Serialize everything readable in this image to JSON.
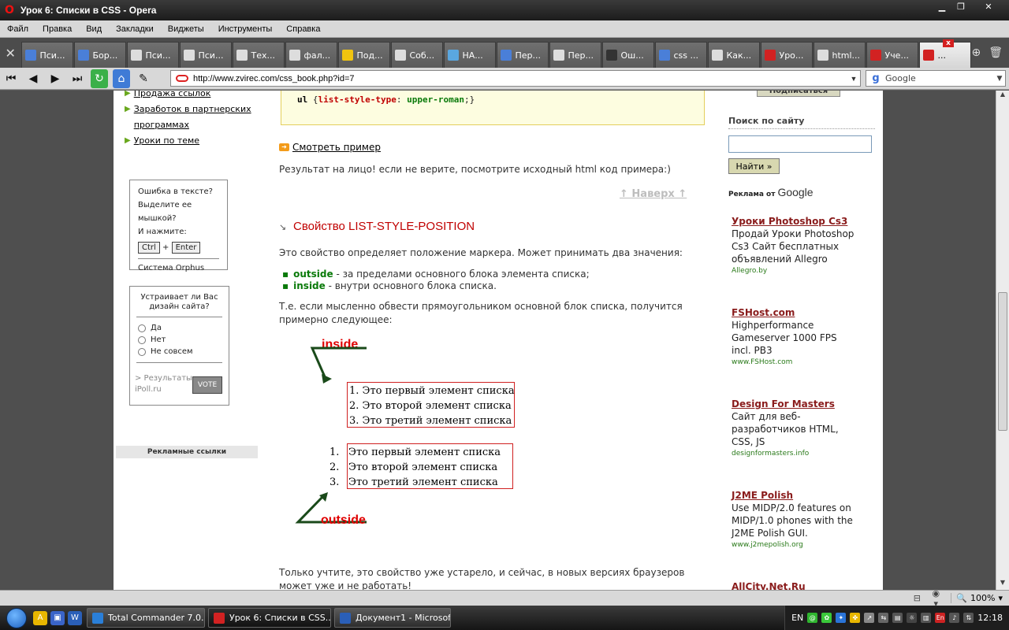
{
  "window": {
    "title": "Урок 6: Списки в CSS - Opera"
  },
  "menu": [
    "Файл",
    "Правка",
    "Вид",
    "Закладки",
    "Виджеты",
    "Инструменты",
    "Справка"
  ],
  "tabs": [
    {
      "label": "Пси...",
      "icon": "google-icon",
      "color": "#4a7fd8"
    },
    {
      "label": "Бор...",
      "icon": "google-icon",
      "color": "#4a7fd8"
    },
    {
      "label": "Пси...",
      "icon": "page-icon",
      "color": "#dddddd"
    },
    {
      "label": "Пси...",
      "icon": "page-icon",
      "color": "#dddddd"
    },
    {
      "label": "Тех...",
      "icon": "page-icon",
      "color": "#dddddd"
    },
    {
      "label": "фал...",
      "icon": "speech-icon",
      "color": "#dddddd"
    },
    {
      "label": "Под...",
      "icon": "font-icon",
      "color": "#f1c40f"
    },
    {
      "label": "Соб...",
      "icon": "page-icon",
      "color": "#dddddd"
    },
    {
      "label": "НА...",
      "icon": "globe-icon",
      "color": "#5aa7e0"
    },
    {
      "label": "Пер...",
      "icon": "google-icon",
      "color": "#4a7fd8"
    },
    {
      "label": "Пер...",
      "icon": "page-icon",
      "color": "#dddddd"
    },
    {
      "label": "Ош...",
      "icon": "speech-icon",
      "color": "#333333"
    },
    {
      "label": "css ...",
      "icon": "google-icon",
      "color": "#4a7fd8"
    },
    {
      "label": "Как...",
      "icon": "page-icon",
      "color": "#dddddd"
    },
    {
      "label": "Уро...",
      "icon": "opera-page-icon",
      "color": "#d22222"
    },
    {
      "label": "html...",
      "icon": "speech-icon",
      "color": "#dddddd"
    },
    {
      "label": "Уче...",
      "icon": "opera-page-icon",
      "color": "#d22222"
    },
    {
      "label": "...",
      "icon": "opera-page-icon",
      "color": "#d22222",
      "active": true
    }
  ],
  "address": {
    "url": "http://www.zvirec.com/css_book.php?id=7",
    "search_engine": "Google"
  },
  "left": {
    "links": [
      "Продажа ссылок",
      "Заработок в партнерских программах",
      "Уроки по теме"
    ],
    "orphus": {
      "line1": "Ошибка в тексте?",
      "line2": "Выделите ее мышкой?",
      "line3": "И нажмите:",
      "key1": "Ctrl",
      "plus": "+",
      "key2": "Enter",
      "footer": "Система Orphus"
    },
    "poll": {
      "question": "Устраивает ли Вас дизайн сайта?",
      "options": [
        "Да",
        "Нет",
        "Не совсем"
      ],
      "results": "> Результаты",
      "source": "iPoll.ru",
      "vote": "VOTE"
    },
    "ads_header": "Рекламные ссылки"
  },
  "main": {
    "code_line2_selector": "ul",
    "code_line2_prop": "list-style-type",
    "code_line2_value": "upper-roman",
    "example_link": "Смотреть пример",
    "result_text": "Результат на лицо! если не верите, посмотрите исходный html код примера:)",
    "top_link": "↑ Наверх ↑",
    "heading": "Свойство LIST-STYLE-POSITION",
    "intro": "Это свойство определяет положение маркера. Может принимать два значения:",
    "bullets": [
      {
        "keyword": "outside",
        "text": " - за пределами основного блока элемента списка;"
      },
      {
        "keyword": "inside",
        "text": " - внутри основного блока списка."
      }
    ],
    "explain": "Т.е. если мысленно обвести прямоугольником основной блок списка, получится примерно следующее:",
    "diagram": {
      "inside_label": "inside",
      "outside_label": "outside",
      "inside_items": [
        "1. Это первый элемент списка",
        "2. Это второй элемент списка",
        "3. Это третий элемент списка"
      ],
      "outside_numbers": [
        "1.",
        "2.",
        "3."
      ],
      "outside_items": [
        "Это первый элемент списка",
        "Это второй элемент списка",
        "Это третий элемент списка"
      ]
    },
    "footer_text": "Только учтите, это свойство уже устарело, и сейчас, в новых версиях браузеров может уже и не работать!"
  },
  "right": {
    "top_button": "Подписаться",
    "search_title": "Поиск по сайту",
    "search_button": "Найти »",
    "ads_by": "Реклама от",
    "google": "Google",
    "ads": [
      {
        "title": "Уроки Photoshop Cs3",
        "body": "Продай Уроки Photoshop Cs3 Сайт бесплатных объявлений Allegro",
        "url": "Allegro.by"
      },
      {
        "title": "FSHost.com",
        "body": "Highperformance Gameserver 1000 FPS incl. PB3",
        "url": "www.FSHost.com"
      },
      {
        "title": "Design For Masters",
        "body": "Сайт для веб-разработчиков HTML, CSS, JS",
        "url": "designformasters.info"
      },
      {
        "title": "J2ME Polish",
        "body": "Use MIDP/2.0 features on MIDP/1.0 phones with the J2ME Polish GUI.",
        "url": "www.j2mepolish.org"
      },
      {
        "title": "AllCity.Net.Ru",
        "body": "",
        "url": ""
      }
    ]
  },
  "status": {
    "zoom": "100%"
  },
  "taskbar": {
    "tasks": [
      {
        "label": "Total Commander 7.0...",
        "color": "#2a7fd8"
      },
      {
        "label": "Урок 6: Списки в CSS...",
        "color": "#d22222",
        "active": true
      },
      {
        "label": "Документ1 - Microsof...",
        "color": "#2a5fb8"
      }
    ],
    "lang": "En",
    "lang2": "EN",
    "time": "12:18"
  }
}
